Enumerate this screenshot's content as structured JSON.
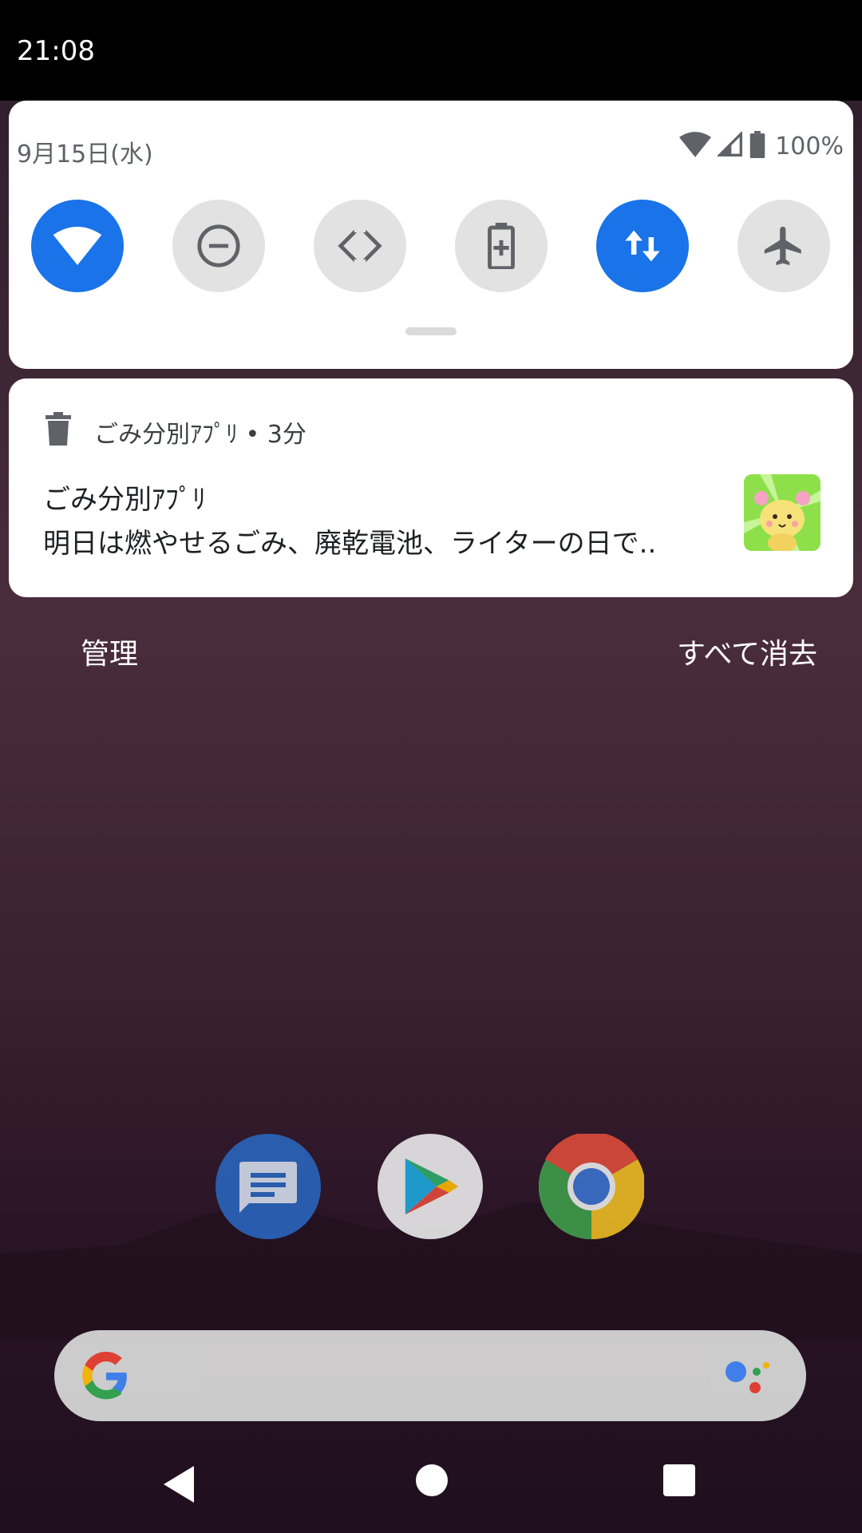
{
  "status_bar": {
    "time": "21:08"
  },
  "quick_settings": {
    "date": "9月15日(水)",
    "battery_percent": "100%",
    "tiles": [
      {
        "name": "wifi",
        "state": "on"
      },
      {
        "name": "do-not-disturb",
        "state": "off"
      },
      {
        "name": "auto-rotate",
        "state": "off"
      },
      {
        "name": "battery-saver",
        "state": "off"
      },
      {
        "name": "mobile-data",
        "state": "on"
      },
      {
        "name": "airplane-mode",
        "state": "off"
      }
    ]
  },
  "notification": {
    "header": "ごみ分別ｱﾌﾟﾘ • 3分",
    "title": "ごみ分別ｱﾌﾟﾘ",
    "text": "明日は燃やせるごみ、廃乾電池、ライターの日で..",
    "app_icon": "trash-icon"
  },
  "actions": {
    "manage": "管理",
    "clear_all": "すべて消去"
  },
  "dock": [
    "messages-app-icon",
    "play-store-app-icon",
    "chrome-app-icon"
  ],
  "navigation": [
    "back-button",
    "home-button",
    "recents-button"
  ],
  "colors": {
    "accent": "#1a73e8",
    "tile_off": "#e2e2e2",
    "icon_gray": "#5f6368"
  }
}
